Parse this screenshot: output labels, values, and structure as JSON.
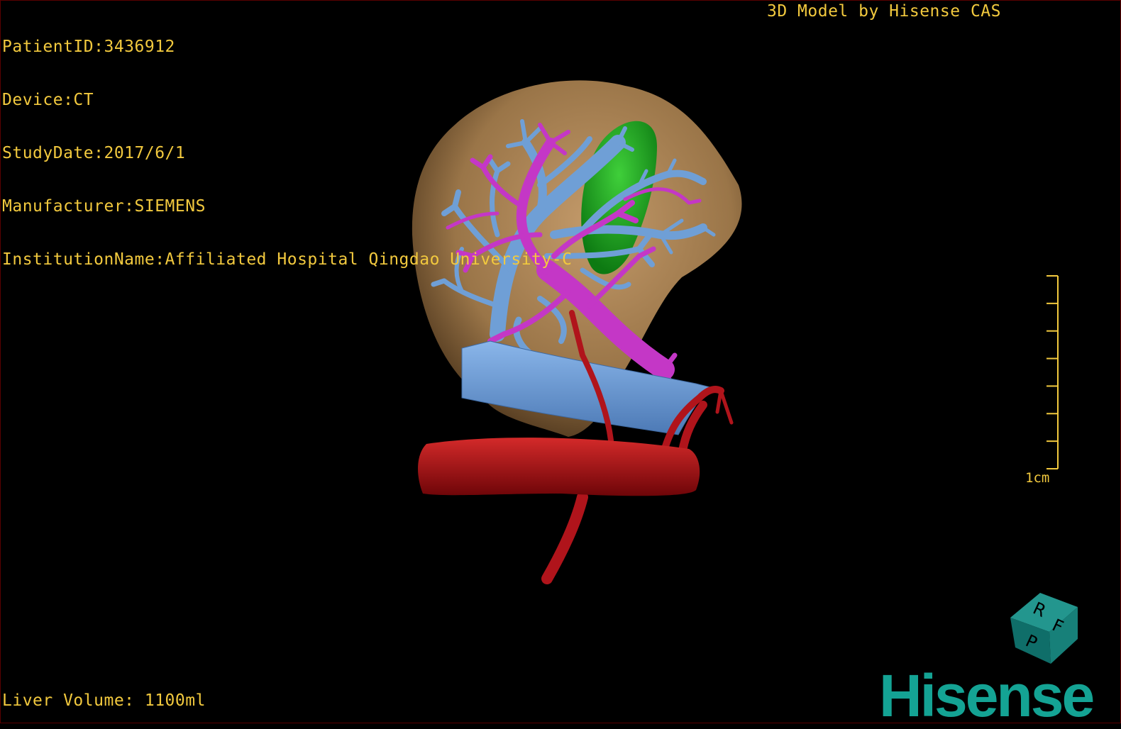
{
  "info": {
    "patient_id": "PatientID:3436912",
    "device": "Device:CT",
    "study_date": "StudyDate:2017/6/1",
    "manufacturer": "Manufacturer:SIEMENS",
    "institution": "InstitutionName:Affiliated Hospital Qingdao University-C"
  },
  "header": {
    "title": "3D Model by Hisense CAS"
  },
  "footer": {
    "liver_volume": "Liver Volume: 1100ml"
  },
  "scale_bar": {
    "label": "1cm",
    "tick_count": 8
  },
  "orientation_cube": {
    "faces": [
      "R",
      "F",
      "P"
    ],
    "color": "#1a7f7a"
  },
  "brand": {
    "logo_text": "Hisense",
    "color": "#14a394"
  },
  "colors": {
    "hud_text": "#f2c93e",
    "liver": "#a37a4d",
    "gallbladder": "#1fa21f",
    "portal_vein": "#c437c6",
    "hepatic_vein": "#6f9fd6",
    "artery": "#b0141b"
  }
}
